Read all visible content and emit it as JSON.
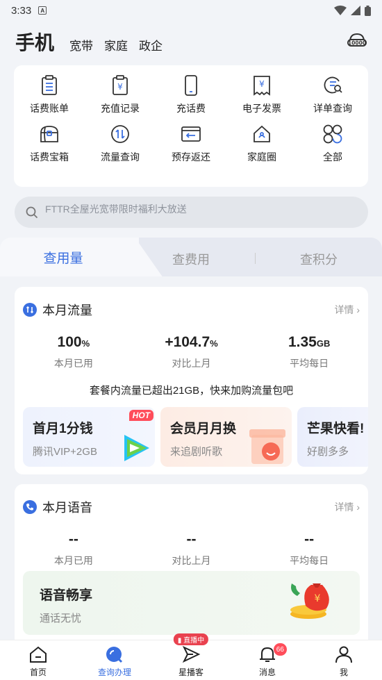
{
  "status_bar": {
    "time": "3:33"
  },
  "top_nav": {
    "main": "手机",
    "tabs": [
      "宽带",
      "家庭",
      "政企"
    ]
  },
  "grid": [
    {
      "label": "话费账单",
      "icon": "bill-icon"
    },
    {
      "label": "充值记录",
      "icon": "recharge-record-icon"
    },
    {
      "label": "充话费",
      "icon": "phone-icon"
    },
    {
      "label": "电子发票",
      "icon": "invoice-icon"
    },
    {
      "label": "详单查询",
      "icon": "detail-search-icon"
    },
    {
      "label": "话费宝箱",
      "icon": "treasure-box-icon"
    },
    {
      "label": "流量查询",
      "icon": "data-query-icon"
    },
    {
      "label": "预存返还",
      "icon": "prestore-return-icon"
    },
    {
      "label": "家庭圈",
      "icon": "home-circle-icon"
    },
    {
      "label": "全部",
      "icon": "all-icon"
    }
  ],
  "search": {
    "placeholder": "FTTR全屋光宽带限时福利大放送"
  },
  "tabs": {
    "active": "查用量",
    "t2": "查费用",
    "t3": "查积分"
  },
  "data_card": {
    "title": "本月流量",
    "detail": "详情",
    "stats": [
      {
        "value": "100",
        "unit": "%",
        "label": "本月已用"
      },
      {
        "value": "+104.7",
        "unit": "%",
        "label": "对比上月"
      },
      {
        "value": "1.35",
        "unit": "GB",
        "label": "平均每日"
      }
    ],
    "notice": "套餐内流量已超出21GB，快来加购流量包吧",
    "promos": [
      {
        "title": "首月1分钱",
        "sub": "腾讯VIP+2GB",
        "badge": "HOT"
      },
      {
        "title": "会员月月换",
        "sub": "来追剧听歌"
      },
      {
        "title": "芒果快看!",
        "sub": "好剧多多"
      }
    ]
  },
  "voice_card": {
    "title": "本月语音",
    "detail": "详情",
    "stats": [
      {
        "value": "--",
        "label": "本月已用"
      },
      {
        "value": "--",
        "label": "对比上月"
      },
      {
        "value": "--",
        "label": "平均每日"
      }
    ],
    "banner": {
      "title": "语音畅享",
      "sub": "通话无忧"
    }
  },
  "bottom_nav": {
    "home": "首页",
    "service": "查询办理",
    "star": "星播客",
    "star_live": "直播中",
    "messages": "消息",
    "messages_badge": "66",
    "me": "我"
  },
  "colors": {
    "accent": "#3a6fe0",
    "badge": "#ff4d5a"
  }
}
